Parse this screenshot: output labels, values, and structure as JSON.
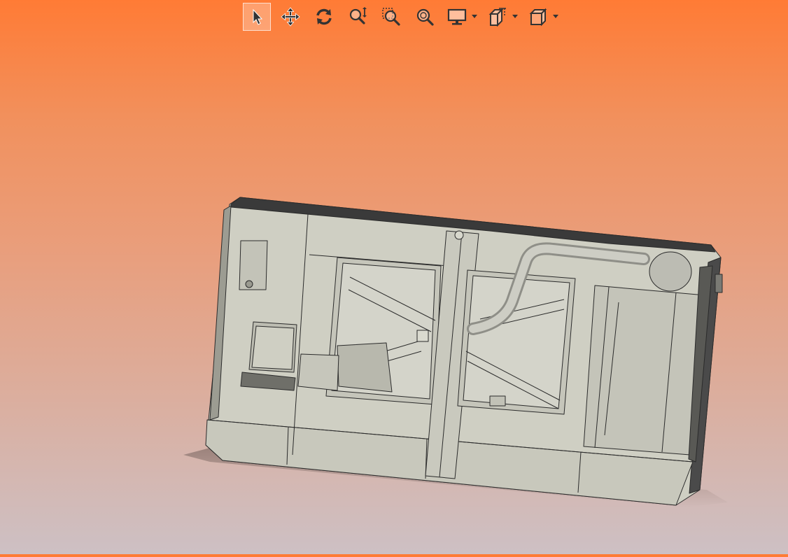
{
  "toolbar": {
    "tools": [
      {
        "id": "select",
        "icon": "select-arrow-icon",
        "active": true
      },
      {
        "id": "pan",
        "icon": "pan-move-icon",
        "active": false
      },
      {
        "id": "rotate",
        "icon": "rotate-icon",
        "active": false
      },
      {
        "id": "zoom",
        "icon": "zoom-in-out-icon",
        "active": false
      },
      {
        "id": "zoom-window",
        "icon": "zoom-window-icon",
        "active": false
      },
      {
        "id": "zoom-fit",
        "icon": "zoom-fit-icon",
        "active": false
      },
      {
        "id": "display-mode",
        "icon": "monitor-icon",
        "has_dropdown": true
      },
      {
        "id": "section",
        "icon": "section-view-icon",
        "has_dropdown": true
      },
      {
        "id": "standard-views",
        "icon": "view-cube-icon",
        "has_dropdown": true
      }
    ]
  },
  "viewport": {
    "model": "generator-enclosure-assembly",
    "background_colors": [
      "#ff7b35",
      "#cdc0c4"
    ],
    "model_color": "#cfcfc3"
  }
}
